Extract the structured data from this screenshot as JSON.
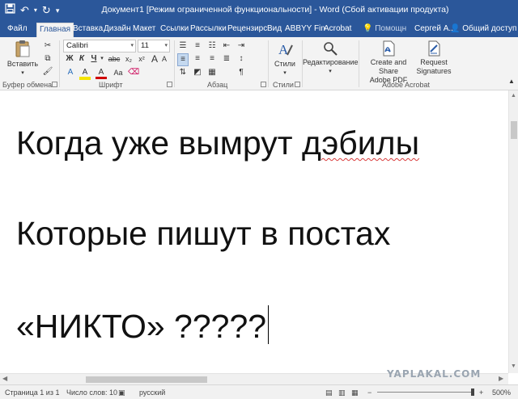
{
  "window": {
    "title": "Документ1 [Режим ограниченной функциональности] - Word (Сбой активации продукта)"
  },
  "qat": {
    "save_icon": "save-icon",
    "undo_icon": "undo-icon",
    "redo_icon": "redo-icon",
    "customize_icon": "customize-icon"
  },
  "tabs": [
    {
      "label": "Файл"
    },
    {
      "label": "Главная"
    },
    {
      "label": "Вставка"
    },
    {
      "label": "Дизайн"
    },
    {
      "label": "Макет"
    },
    {
      "label": "Ссылки"
    },
    {
      "label": "Рассылки"
    },
    {
      "label": "Рецензирс"
    },
    {
      "label": "Вид"
    },
    {
      "label": "ABBYY Fin"
    },
    {
      "label": "Acrobat"
    }
  ],
  "tabs_right": {
    "help": "Помощн",
    "user": "Сергей А...",
    "share": "Общий доступ"
  },
  "ribbon": {
    "clipboard": {
      "paste_label": "Вставить",
      "group_label": "Буфер обмена"
    },
    "font": {
      "font_name": "Calibri",
      "font_size": "11",
      "bold": "Ж",
      "italic": "К",
      "underline": "Ч",
      "strikethrough": "abc",
      "subscript": "x₂",
      "superscript": "x²",
      "grow": "A",
      "shrink": "A",
      "change_case": "Aa",
      "font_color": "A",
      "highlight": "A",
      "group_label": "Шрифт"
    },
    "paragraph": {
      "group_label": "Абзац"
    },
    "styles": {
      "styles_label": "Стили",
      "group_label": "Стили"
    },
    "editing": {
      "label": "Редактирование"
    },
    "acrobat": {
      "create_share_line1": "Create and Share",
      "create_share_line2": "Adobe PDF",
      "request_line1": "Request",
      "request_line2": "Signatures",
      "group_label": "Adobe Acrobat"
    }
  },
  "document": {
    "line1_a": "Когда уже вымрут ",
    "line1_b": "дэбилы",
    "line2": "Которые пишут в постах",
    "line3": "«НИКТО» ?????"
  },
  "watermark": "YAPLAKAL.COM",
  "status": {
    "page": "Страница 1 из 1",
    "words": "Число слов: 10",
    "language": "русский",
    "zoom": "500%"
  },
  "colors": {
    "title_bar": "#2b579a",
    "ribbon": "#f3f3f3",
    "spell_underline": "#d83b3b"
  }
}
